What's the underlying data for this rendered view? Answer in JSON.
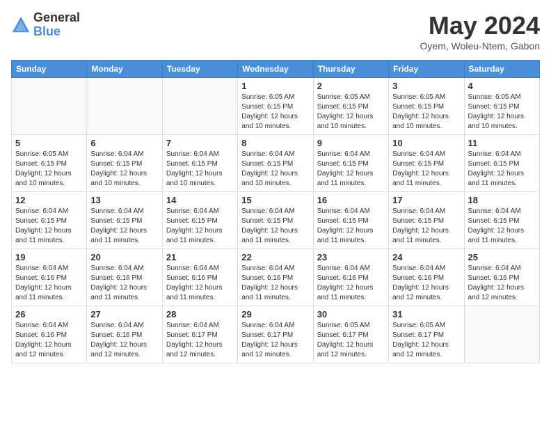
{
  "header": {
    "logo_line1": "General",
    "logo_line2": "Blue",
    "month": "May 2024",
    "location": "Oyem, Woleu-Ntem, Gabon"
  },
  "days_of_week": [
    "Sunday",
    "Monday",
    "Tuesday",
    "Wednesday",
    "Thursday",
    "Friday",
    "Saturday"
  ],
  "weeks": [
    [
      {
        "day": "",
        "info": ""
      },
      {
        "day": "",
        "info": ""
      },
      {
        "day": "",
        "info": ""
      },
      {
        "day": "1",
        "info": "Sunrise: 6:05 AM\nSunset: 6:15 PM\nDaylight: 12 hours\nand 10 minutes."
      },
      {
        "day": "2",
        "info": "Sunrise: 6:05 AM\nSunset: 6:15 PM\nDaylight: 12 hours\nand 10 minutes."
      },
      {
        "day": "3",
        "info": "Sunrise: 6:05 AM\nSunset: 6:15 PM\nDaylight: 12 hours\nand 10 minutes."
      },
      {
        "day": "4",
        "info": "Sunrise: 6:05 AM\nSunset: 6:15 PM\nDaylight: 12 hours\nand 10 minutes."
      }
    ],
    [
      {
        "day": "5",
        "info": "Sunrise: 6:05 AM\nSunset: 6:15 PM\nDaylight: 12 hours\nand 10 minutes."
      },
      {
        "day": "6",
        "info": "Sunrise: 6:04 AM\nSunset: 6:15 PM\nDaylight: 12 hours\nand 10 minutes."
      },
      {
        "day": "7",
        "info": "Sunrise: 6:04 AM\nSunset: 6:15 PM\nDaylight: 12 hours\nand 10 minutes."
      },
      {
        "day": "8",
        "info": "Sunrise: 6:04 AM\nSunset: 6:15 PM\nDaylight: 12 hours\nand 10 minutes."
      },
      {
        "day": "9",
        "info": "Sunrise: 6:04 AM\nSunset: 6:15 PM\nDaylight: 12 hours\nand 11 minutes."
      },
      {
        "day": "10",
        "info": "Sunrise: 6:04 AM\nSunset: 6:15 PM\nDaylight: 12 hours\nand 11 minutes."
      },
      {
        "day": "11",
        "info": "Sunrise: 6:04 AM\nSunset: 6:15 PM\nDaylight: 12 hours\nand 11 minutes."
      }
    ],
    [
      {
        "day": "12",
        "info": "Sunrise: 6:04 AM\nSunset: 6:15 PM\nDaylight: 12 hours\nand 11 minutes."
      },
      {
        "day": "13",
        "info": "Sunrise: 6:04 AM\nSunset: 6:15 PM\nDaylight: 12 hours\nand 11 minutes."
      },
      {
        "day": "14",
        "info": "Sunrise: 6:04 AM\nSunset: 6:15 PM\nDaylight: 12 hours\nand 11 minutes."
      },
      {
        "day": "15",
        "info": "Sunrise: 6:04 AM\nSunset: 6:15 PM\nDaylight: 12 hours\nand 11 minutes."
      },
      {
        "day": "16",
        "info": "Sunrise: 6:04 AM\nSunset: 6:15 PM\nDaylight: 12 hours\nand 11 minutes."
      },
      {
        "day": "17",
        "info": "Sunrise: 6:04 AM\nSunset: 6:15 PM\nDaylight: 12 hours\nand 11 minutes."
      },
      {
        "day": "18",
        "info": "Sunrise: 6:04 AM\nSunset: 6:15 PM\nDaylight: 12 hours\nand 11 minutes."
      }
    ],
    [
      {
        "day": "19",
        "info": "Sunrise: 6:04 AM\nSunset: 6:16 PM\nDaylight: 12 hours\nand 11 minutes."
      },
      {
        "day": "20",
        "info": "Sunrise: 6:04 AM\nSunset: 6:16 PM\nDaylight: 12 hours\nand 11 minutes."
      },
      {
        "day": "21",
        "info": "Sunrise: 6:04 AM\nSunset: 6:16 PM\nDaylight: 12 hours\nand 11 minutes."
      },
      {
        "day": "22",
        "info": "Sunrise: 6:04 AM\nSunset: 6:16 PM\nDaylight: 12 hours\nand 11 minutes."
      },
      {
        "day": "23",
        "info": "Sunrise: 6:04 AM\nSunset: 6:16 PM\nDaylight: 12 hours\nand 11 minutes."
      },
      {
        "day": "24",
        "info": "Sunrise: 6:04 AM\nSunset: 6:16 PM\nDaylight: 12 hours\nand 12 minutes."
      },
      {
        "day": "25",
        "info": "Sunrise: 6:04 AM\nSunset: 6:16 PM\nDaylight: 12 hours\nand 12 minutes."
      }
    ],
    [
      {
        "day": "26",
        "info": "Sunrise: 6:04 AM\nSunset: 6:16 PM\nDaylight: 12 hours\nand 12 minutes."
      },
      {
        "day": "27",
        "info": "Sunrise: 6:04 AM\nSunset: 6:16 PM\nDaylight: 12 hours\nand 12 minutes."
      },
      {
        "day": "28",
        "info": "Sunrise: 6:04 AM\nSunset: 6:17 PM\nDaylight: 12 hours\nand 12 minutes."
      },
      {
        "day": "29",
        "info": "Sunrise: 6:04 AM\nSunset: 6:17 PM\nDaylight: 12 hours\nand 12 minutes."
      },
      {
        "day": "30",
        "info": "Sunrise: 6:05 AM\nSunset: 6:17 PM\nDaylight: 12 hours\nand 12 minutes."
      },
      {
        "day": "31",
        "info": "Sunrise: 6:05 AM\nSunset: 6:17 PM\nDaylight: 12 hours\nand 12 minutes."
      },
      {
        "day": "",
        "info": ""
      }
    ]
  ]
}
